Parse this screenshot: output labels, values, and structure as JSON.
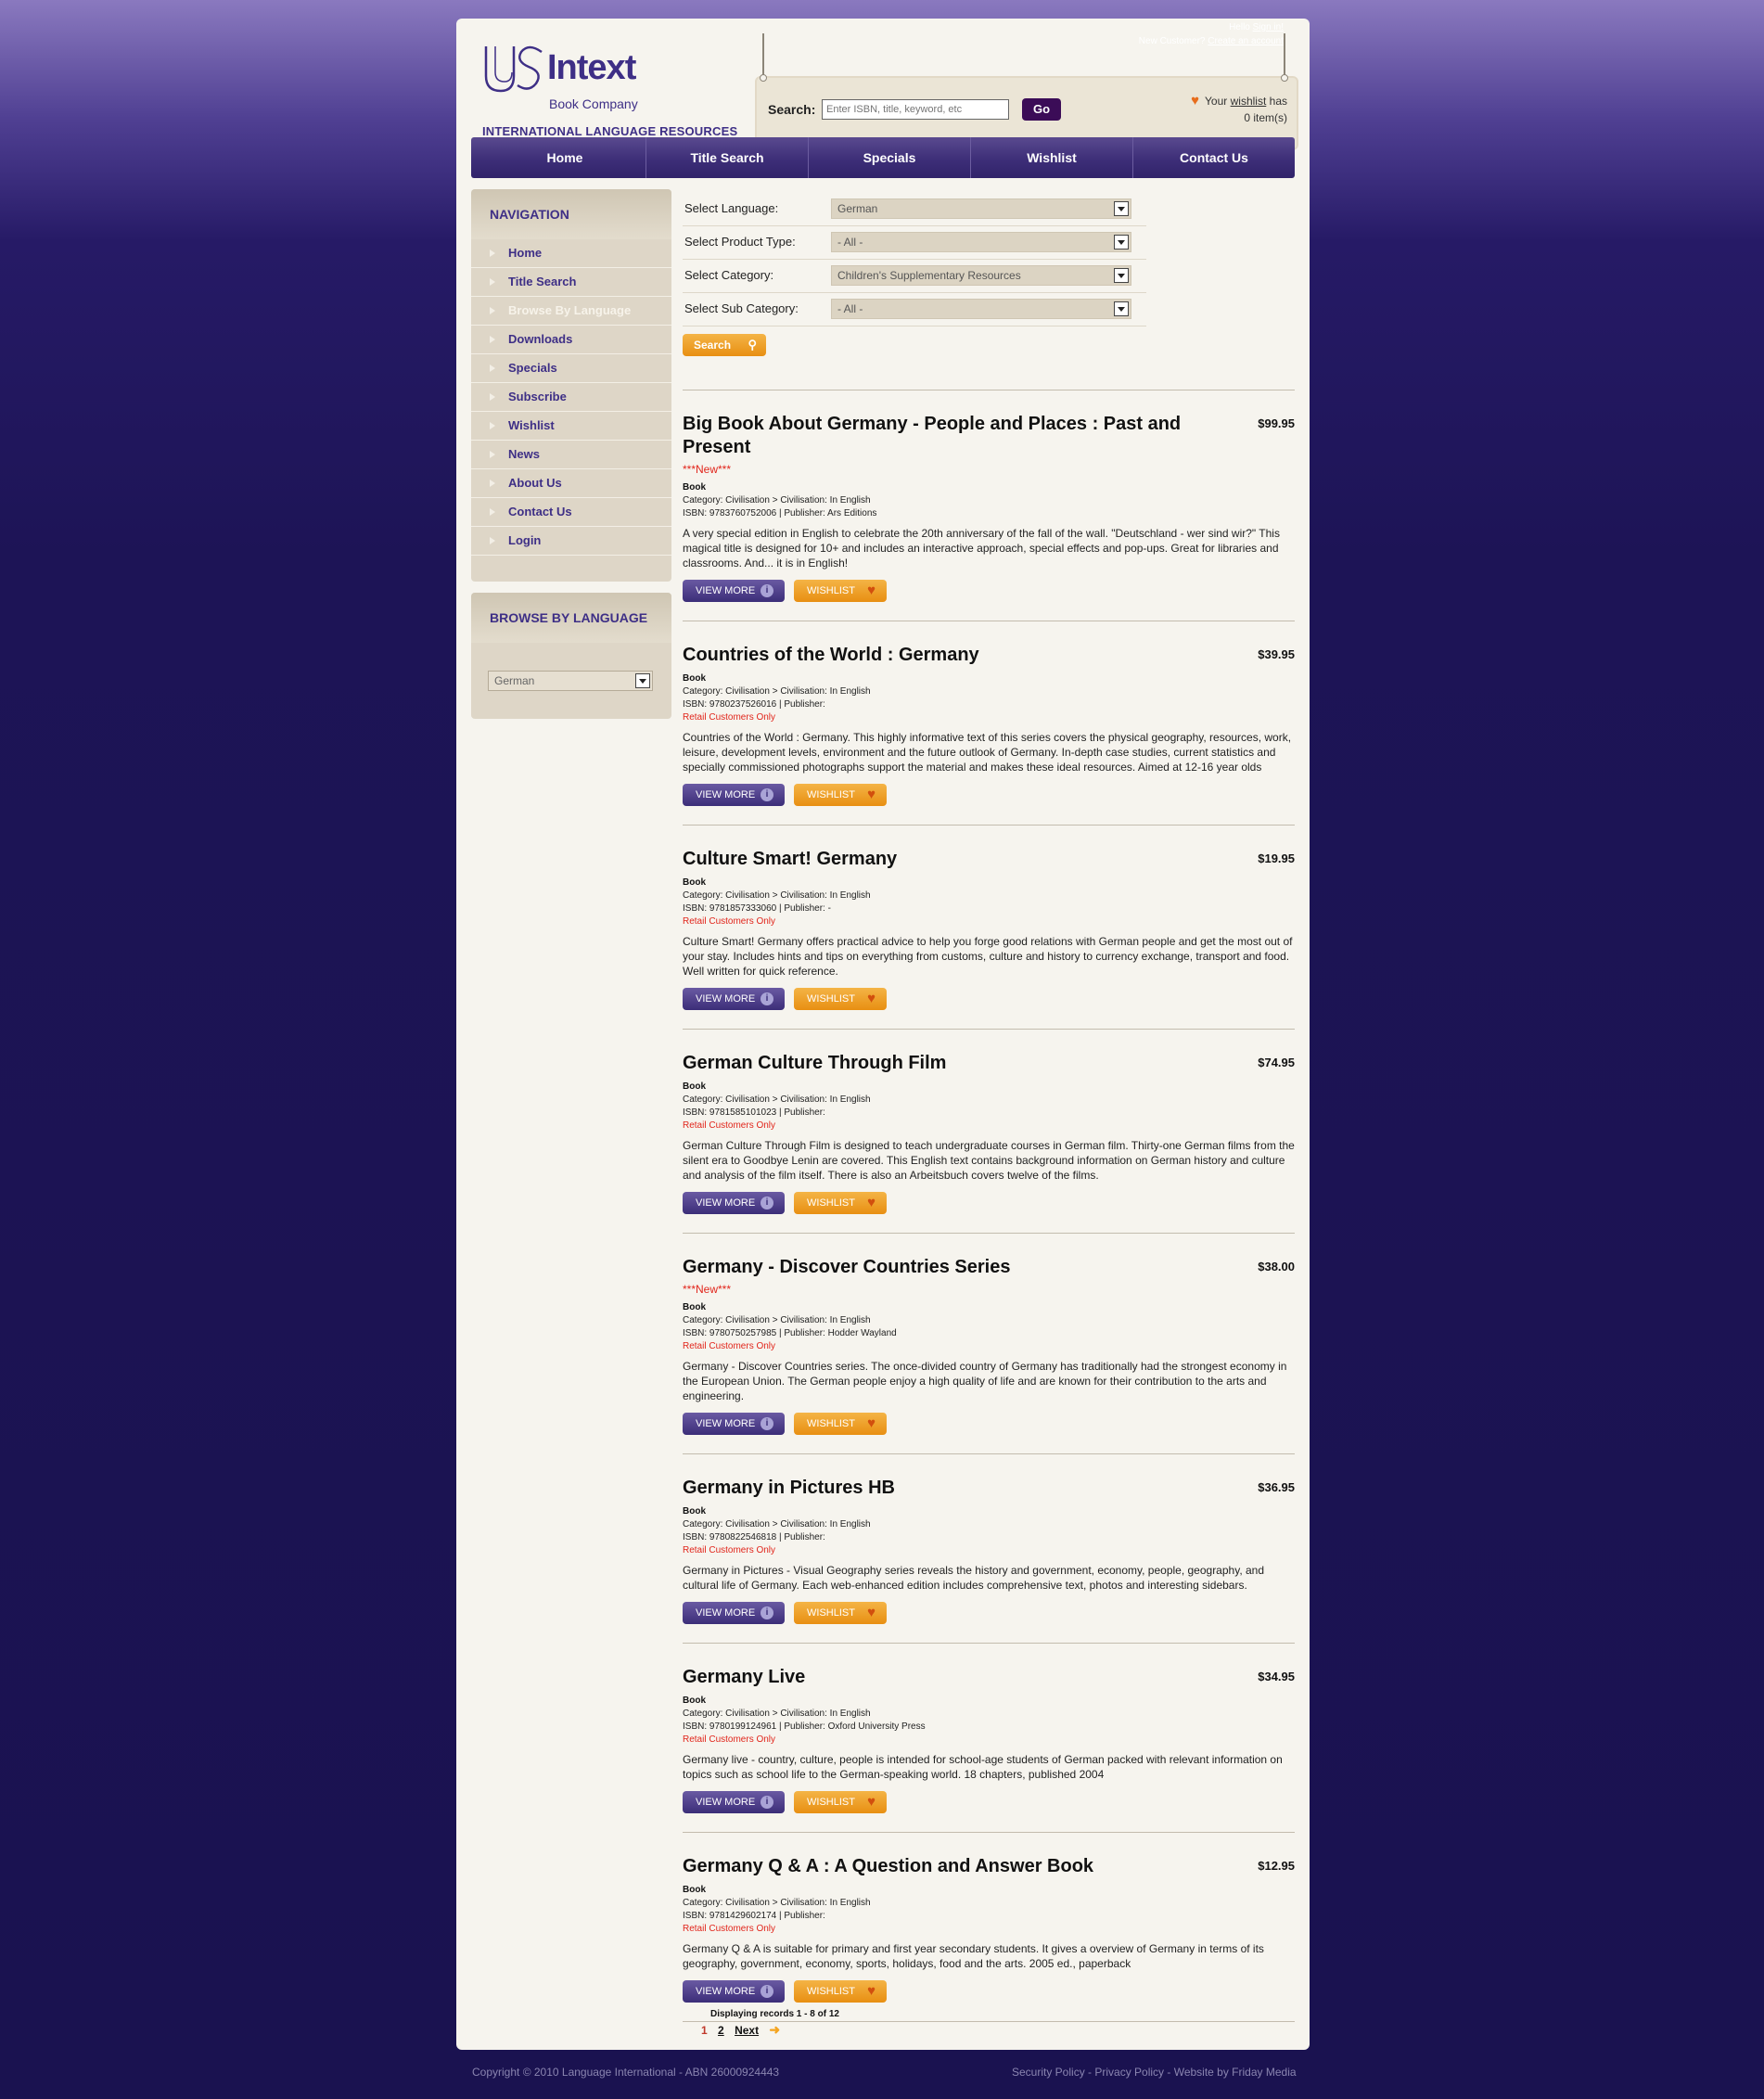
{
  "account": {
    "hello": "Hello",
    "sign_in": "Sign in!",
    "new_customer": "New Customer?",
    "create_account": "Create an account"
  },
  "logo": {
    "name": "Intext",
    "sub": "Book Company",
    "tagline": "INTERNATIONAL LANGUAGE RESOURCES"
  },
  "search": {
    "label": "Search:",
    "placeholder": "Enter ISBN, title, keyword, etc",
    "go": "Go"
  },
  "wishlist_note": {
    "your": "Your",
    "link": "wishlist",
    "has": "has",
    "count": "0 item(s)"
  },
  "topnav": [
    "Home",
    "Title Search",
    "Specials",
    "Wishlist",
    "Contact Us"
  ],
  "sidebar": {
    "heading": "NAVIGATION",
    "items": [
      "Home",
      "Title Search",
      "Browse By Language",
      "Downloads",
      "Specials",
      "Subscribe",
      "Wishlist",
      "News",
      "About Us",
      "Contact Us",
      "Login"
    ],
    "active_index": 2,
    "lang_heading": "BROWSE BY LANGUAGE",
    "lang_value": "German"
  },
  "filters": [
    {
      "label": "Select Language:",
      "value": "German"
    },
    {
      "label": "Select Product Type:",
      "value": "- All -"
    },
    {
      "label": "Select Category:",
      "value": "Children's Supplementary Resources"
    },
    {
      "label": "Select Sub Category:",
      "value": "- All -"
    }
  ],
  "search_button": "Search",
  "view_more": "VIEW MORE",
  "wishlist_btn": "WISHLIST",
  "products": [
    {
      "title": "Big Book About Germany - People and Places : Past and Present",
      "price": "$99.95",
      "new": "***New***",
      "type": "Book",
      "category": "Category: Civilisation > Civilisation: In English",
      "isbn": "ISBN: 9783760752006 | Publisher: Ars Editions",
      "retail": "",
      "desc": "A very special edition in English to celebrate the 20th anniversary of the fall of the wall. \"Deutschland - wer sind wir?\" This magical title is designed for 10+ and includes an interactive approach, special effects and pop-ups. Great for libraries and classrooms. And... it is in English!"
    },
    {
      "title": "Countries of the World : Germany",
      "price": "$39.95",
      "new": "",
      "type": "Book",
      "category": "Category: Civilisation > Civilisation: In English",
      "isbn": "ISBN: 9780237526016 | Publisher:",
      "retail": "Retail Customers Only",
      "desc": "Countries of the World : Germany. This highly informative text of this series covers the physical geography, resources, work, leisure, development levels, environment and the future outlook of Germany. In-depth case studies, current statistics and specially commissioned photographs support the material and makes these ideal resources. Aimed at 12-16 year olds"
    },
    {
      "title": "Culture Smart! Germany",
      "price": "$19.95",
      "new": "",
      "type": "Book",
      "category": "Category: Civilisation > Civilisation: In English",
      "isbn": "ISBN: 9781857333060 | Publisher: -",
      "retail": "Retail Customers Only",
      "desc": "Culture Smart! Germany offers practical advice to help you forge good relations with German people and get the most out of your stay. Includes hints and tips on everything from customs, culture and history to currency exchange, transport and food. Well written for quick reference."
    },
    {
      "title": "German Culture Through Film",
      "price": "$74.95",
      "new": "",
      "type": "Book",
      "category": "Category: Civilisation > Civilisation: In English",
      "isbn": "ISBN: 9781585101023 | Publisher:",
      "retail": "Retail Customers Only",
      "desc": "German Culture Through Film is designed to teach undergraduate courses in German film. Thirty-one German films from the silent era to Goodbye Lenin are covered. This English text contains background information on German history and culture and analysis of the film itself. There is also an Arbeitsbuch covers twelve of the films."
    },
    {
      "title": "Germany - Discover Countries Series",
      "price": "$38.00",
      "new": "***New***",
      "type": "Book",
      "category": "Category: Civilisation > Civilisation: In English",
      "isbn": "ISBN: 9780750257985 | Publisher: Hodder Wayland",
      "retail": "Retail Customers Only",
      "desc": "Germany - Discover Countries series. The once-divided country of Germany has traditionally had the strongest economy in the European Union. The German people enjoy a high quality of life and are known for their contribution to the arts and engineering."
    },
    {
      "title": "Germany in Pictures HB",
      "price": "$36.95",
      "new": "",
      "type": "Book",
      "category": "Category: Civilisation > Civilisation: In English",
      "isbn": "ISBN: 9780822546818 | Publisher:",
      "retail": "Retail Customers Only",
      "desc": "Germany in Pictures - Visual Geography series reveals the history and government, economy, people, geography, and cultural life of Germany. Each web-enhanced edition includes comprehensive text, photos and interesting sidebars."
    },
    {
      "title": "Germany Live",
      "price": "$34.95",
      "new": "",
      "type": "Book",
      "category": "Category: Civilisation > Civilisation: In English",
      "isbn": "ISBN: 9780199124961 | Publisher: Oxford University Press",
      "retail": "Retail Customers Only",
      "desc": "Germany live - country, culture, people is intended for school-age students of German packed with relevant information on topics such as school life to the German-speaking world. 18 chapters, published 2004"
    },
    {
      "title": "Germany Q & A : A Question and Answer Book",
      "price": "$12.95",
      "new": "",
      "type": "Book",
      "category": "Category: Civilisation > Civilisation: In English",
      "isbn": "ISBN: 9781429602174 | Publisher:",
      "retail": "Retail Customers Only",
      "desc": "Germany Q & A is suitable for primary and first year secondary students. It gives a overview of Germany in terms of its geography, government, economy, sports, holidays, food and the arts. 2005 ed., paperback"
    }
  ],
  "pager": {
    "text": "Displaying records 1 - 8 of 12",
    "pages": [
      "1",
      "2"
    ],
    "next": "Next"
  },
  "footer": {
    "copyright": "Copyright © 2010 Language International - ABN 26000924443",
    "links": "Security Policy - Privacy Policy - Website by Friday Media"
  },
  "colors": {
    "brand_purple": "#3e2f86",
    "accent_orange": "#e88f12",
    "alert_red": "#e1251b"
  }
}
